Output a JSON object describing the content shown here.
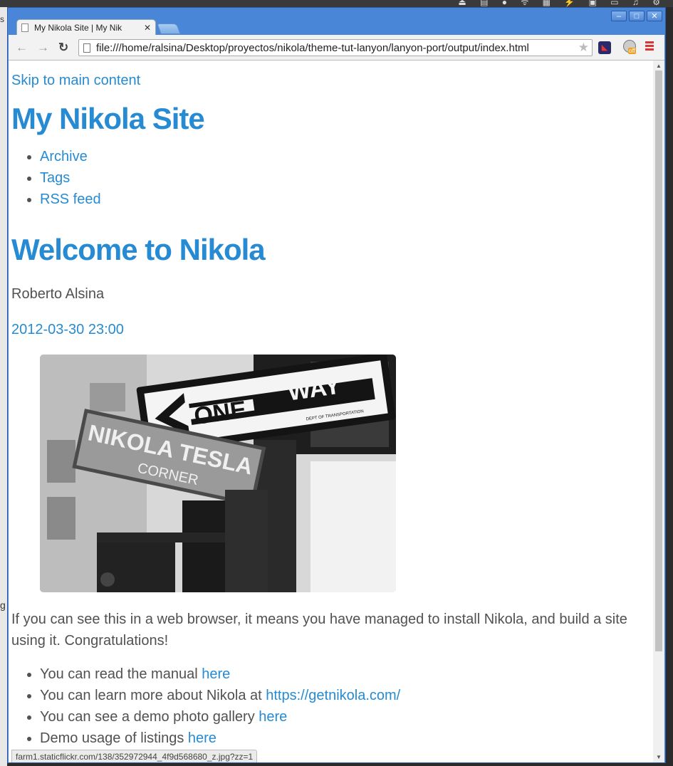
{
  "browser": {
    "tab_title": "My Nikola Site | My Nik",
    "url": "file:///home/ralsina/Desktop/proyectos/nikola/theme-tut-lanyon/lanyon-port/output/index.html",
    "status_url": "farm1.staticflickr.com/138/352972944_4f9d568680_z.jpg?zz=1",
    "ext_badge": "off"
  },
  "page": {
    "skip_link": "Skip to main content",
    "site_title": "My Nikola Site",
    "nav": [
      "Archive",
      "Tags",
      "RSS feed"
    ],
    "post_title": "Welcome to Nikola",
    "author": "Roberto Alsina",
    "date": "2012-03-30 23:00",
    "image": {
      "sign_text_1": "ONE",
      "sign_text_2": "WAY",
      "sign_small": "DEPT OF TRANSPORTATION",
      "street_text_1": "NIKOLA TESLA",
      "street_text_2": "CORNER"
    },
    "intro": "If you can see this in a web browser, it means you have managed to install Nikola, and build a site using it. Congratulations!",
    "items": [
      {
        "text": "You can read the manual ",
        "link": "here"
      },
      {
        "text": "You can learn more about Nikola at ",
        "link": "https://getnikola.com/"
      },
      {
        "text": "You can see a demo photo gallery ",
        "link": "here"
      },
      {
        "text": "Demo usage of listings ",
        "link": "here"
      }
    ]
  },
  "colors": {
    "link": "#268bd2",
    "text": "#515151",
    "window_frame": "#4a86d8"
  }
}
